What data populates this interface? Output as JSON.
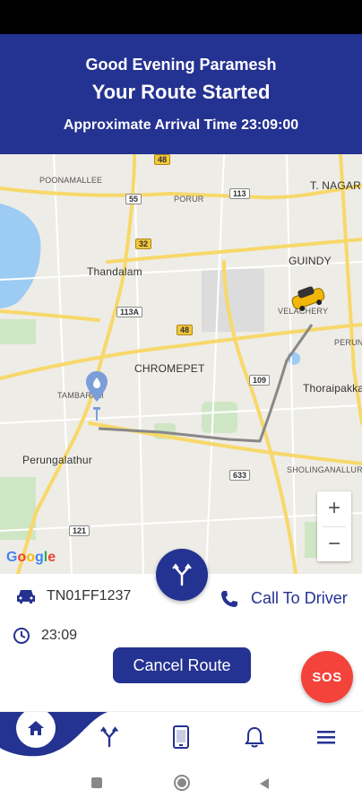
{
  "header": {
    "greeting": "Good Evening Paramesh",
    "title": "Your Route Started",
    "arrival": "Approximate Arrival Time 23:09:00"
  },
  "map": {
    "labels": {
      "poonamallee": "POONAMALLEE",
      "porur": "PORUR",
      "t_nagar": "T. NAGAR",
      "thandalam": "Thandalam",
      "guindy": "GUINDY",
      "velachery": "VELACHERY",
      "chromepet": "CHROMEPET",
      "perun": "PERUN",
      "thoraipakkam": "Thoraipakka",
      "tambaram": "TAMBARAM",
      "perungalathur": "Perungalathur",
      "sholinganallur": "SHOLINGANALLUR"
    },
    "shields": {
      "s48a": "48",
      "s55": "55",
      "s113a": "113",
      "s32": "32",
      "s113b": "113A",
      "s48b": "48",
      "s109": "109",
      "s633": "633",
      "s121": "121"
    },
    "zoom_in": "+",
    "zoom_out": "−",
    "attribution": "Google"
  },
  "trip": {
    "vehicle_number": "TN01FF1237",
    "time": "23:09",
    "call_driver": "Call To Driver",
    "cancel_label": "Cancel Route",
    "sos_label": "SOS"
  },
  "nav": {
    "items": [
      "home-icon",
      "route-icon",
      "device-icon",
      "bell-icon",
      "menu-icon"
    ]
  },
  "colors": {
    "primary": "#243291",
    "sos": "#f3433a",
    "map_bg": "#eeece6",
    "road_yellow": "#f7d86a",
    "route_line": "#888888"
  }
}
